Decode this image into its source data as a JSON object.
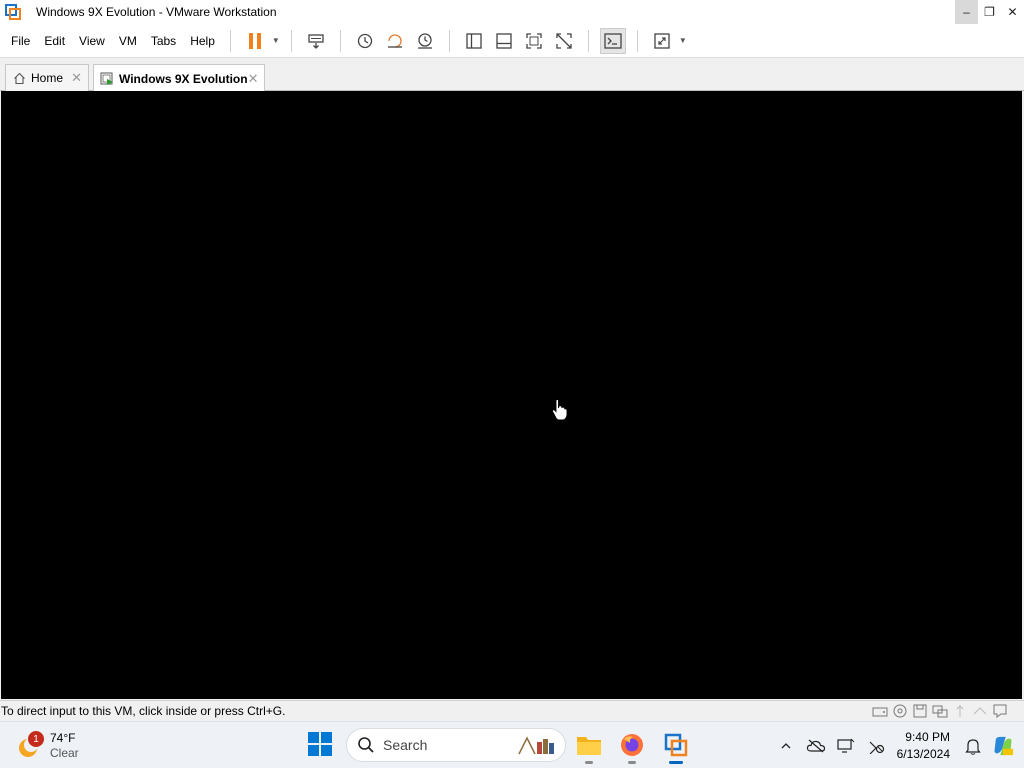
{
  "window": {
    "title": "Windows 9X Evolution - VMware Workstation",
    "minimize_label": "–",
    "restore_label": "❐",
    "close_label": "✕"
  },
  "menu": {
    "file": "File",
    "edit": "Edit",
    "view": "View",
    "vm": "VM",
    "tabs": "Tabs",
    "help": "Help"
  },
  "toolbar": {
    "icons": [
      "pause-icon",
      "send-ctrl-alt-del-icon",
      "snapshot-take-icon",
      "snapshot-revert-icon",
      "snapshot-manager-icon",
      "library-icon",
      "thumbnail-bar-icon",
      "full-screen-icon",
      "unity-icon",
      "console-view-icon",
      "stretch-guest-icon"
    ]
  },
  "tabs": [
    {
      "label": "Home",
      "close": "✕"
    },
    {
      "label": "Windows 9X Evolution",
      "close": "✕"
    }
  ],
  "status": {
    "message": "To direct input to this VM, click inside or press Ctrl+G."
  },
  "taskbar": {
    "weather_badge": "1",
    "temperature": "74°F",
    "condition": "Clear",
    "search_label": "Search",
    "time": "9:40 PM",
    "date": "6/13/2024"
  },
  "colors": {
    "pause_accent": "#f0821e",
    "vm_background": "#000000",
    "start_blue": "#0078d4",
    "active_indicator": "#0067c0"
  }
}
